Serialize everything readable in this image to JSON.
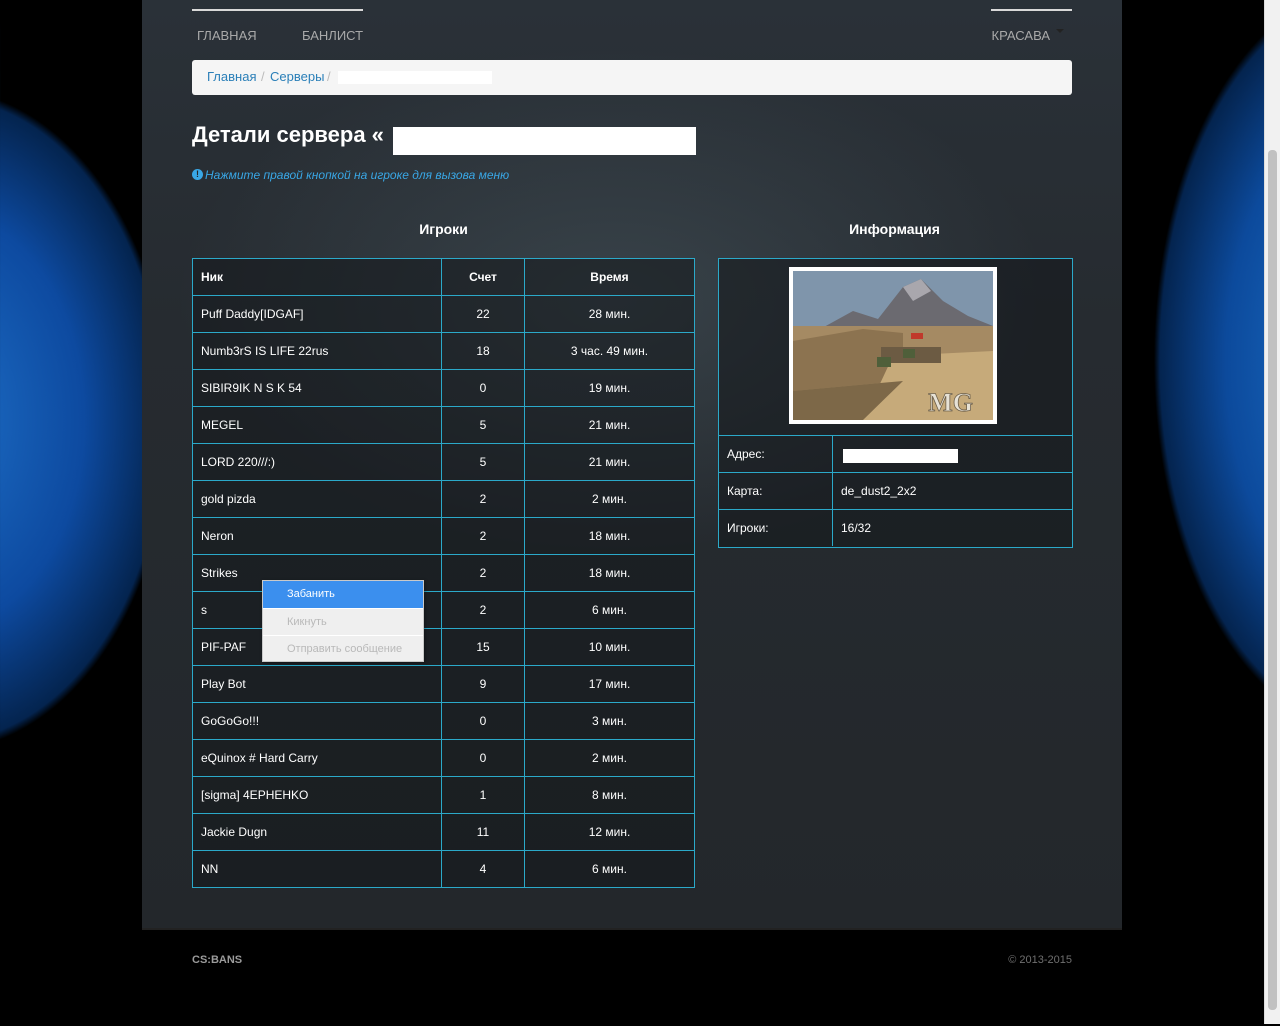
{
  "nav": {
    "home": "ГЛАВНАЯ",
    "banlist": "БАНЛИСТ",
    "user": "КРАСАВА"
  },
  "breadcrumb": {
    "home": "Главная",
    "servers": "Серверы",
    "sep": "/"
  },
  "page": {
    "title": "Детали сервера «",
    "hint": "Нажмите правой кнопкой на игроке для вызова меню",
    "players_heading": "Игроки",
    "info_heading": "Информация"
  },
  "players_table": {
    "headers": [
      "Ник",
      "Счет",
      "Время"
    ],
    "rows": [
      [
        "Puff Daddy[IDGAF]",
        "22",
        "28 мин."
      ],
      [
        "Numb3rS IS LIFE 22rus",
        "18",
        "3 час. 49 мин."
      ],
      [
        "SIBIR9IK N S K 54",
        "0",
        "19 мин."
      ],
      [
        "MEGEL",
        "5",
        "21 мин."
      ],
      [
        "LORD 220///:)",
        "5",
        "21 мин."
      ],
      [
        "gold pizda",
        "2",
        "2 мин."
      ],
      [
        "Neron",
        "2",
        "18 мин."
      ],
      [
        "Strikes",
        "2",
        "18 мин."
      ],
      [
        "s",
        "2",
        "6 мин."
      ],
      [
        "PIF-PAF",
        "15",
        "10 мин."
      ],
      [
        "Play Bot",
        "9",
        "17 мин."
      ],
      [
        "GoGoGo!!!",
        "0",
        "3 мин."
      ],
      [
        "eQuinox # Hard Carry",
        "0",
        "2 мин."
      ],
      [
        "[sigma] 4EPHEHKO",
        "1",
        "8 мин."
      ],
      [
        "Jackie Dugn",
        "11",
        "12 мин."
      ],
      [
        "NN",
        "4",
        "6 мин."
      ]
    ]
  },
  "info_table": {
    "address_label": "Адрес:",
    "map_label": "Карта:",
    "map_value": "de_dust2_2x2",
    "players_label": "Игроки:",
    "players_value": "16/32",
    "map_watermark": "MG"
  },
  "context_menu": {
    "items": [
      "Забанить",
      "Кикнуть",
      "Отправить сообщение"
    ],
    "active_index": 0
  },
  "footer": {
    "brand": "CS:BANS",
    "copyright": "© 2013-2015"
  },
  "colors": {
    "accent": "#2ba9c9",
    "link": "#2a7fb8",
    "hint": "#39a7e6",
    "menu_active": "#3b8fee"
  }
}
